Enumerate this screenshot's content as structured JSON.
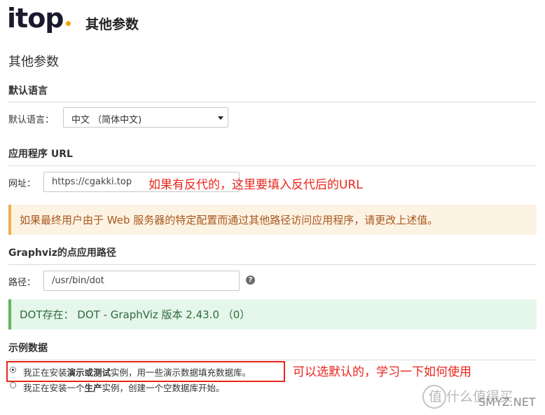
{
  "header": {
    "logo_text": "itop",
    "title": "其他参数"
  },
  "page_title": "其他参数",
  "default_language": {
    "section_title": "默认语言",
    "label": "默认语言：",
    "selected_value": "中文 （简体中文)"
  },
  "app_url": {
    "section_title": "应用程序 URL",
    "label": "网址：",
    "value": "https://cgakki.top",
    "annotation": "如果有反代的，这里要填入反代后的URL",
    "warning": "如果最终用户由于 Web 服务器的特定配置而通过其他路径访问应用程序，请更改上述值。"
  },
  "graphviz": {
    "section_title": "Graphviz的点应用路径",
    "label": "路径：",
    "value": "/usr/bin/dot",
    "help_icon_glyph": "?",
    "success": "DOT存在： DOT - GraphViz 版本 2.43.0 （0）"
  },
  "sample_data": {
    "section_title": "示例数据",
    "option_demo_prefix": "我正在安装",
    "option_demo_bold": "演示或测试",
    "option_demo_suffix": "实例，用一些演示数据填充数据库。",
    "option_prod_prefix": "我正在安装一个",
    "option_prod_bold": "生产",
    "option_prod_suffix": "实例，创建一个空数据库开始。",
    "annotation": "可以选默认的，学习一下如何使用"
  },
  "watermark": {
    "text": "值 什么值得买",
    "sub": "SMYZ.NET"
  },
  "colors": {
    "accent_orange": "#f4a300",
    "annotation_red": "#e8251c",
    "warning_bg": "#fdf3e3",
    "success_bg": "#e5f6ea"
  }
}
